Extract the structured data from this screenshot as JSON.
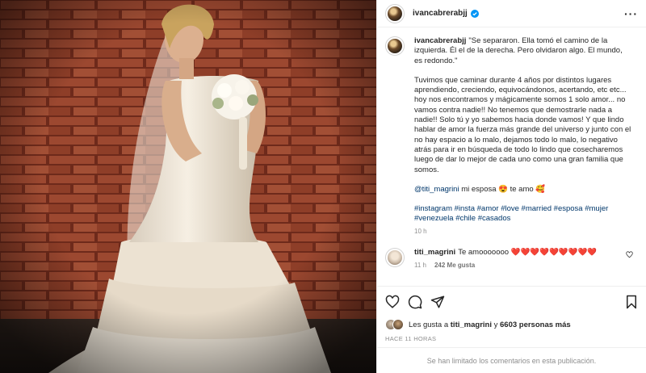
{
  "post": {
    "author": "ivancabrerabjj",
    "more_icon": "more-horizontal-icon",
    "caption": {
      "author": "ivancabrerabjj",
      "quote": "\"Se separaron. Ella tomó el camino de la izquierda. Él el de la derecha. Pero olvidaron algo. El mundo, es redondo.\"",
      "paragraph": "Tuvimos que caminar durante 4 años por distintos lugares aprendiendo, creciendo, equivocándonos, acertando, etc etc... hoy nos encontramos y mágicamente somos 1 solo amor... no vamos contra nadie!! No tenemos que demostrarle nada a nadie!! Solo tú y yo sabemos hacia donde vamos! Y que lindo hablar de amor la fuerza más grande del universo y junto con el no hay espacio a lo malo, dejamos todo lo malo, lo negativo atrás para ir en búsqueda de todo lo lindo que cosecharemos luego de dar lo mejor de cada uno como una gran familia que somos.",
      "mention": "@titi_magrini",
      "mention_text": " mi esposa 😍 te amo 🥰",
      "hashtags": "#instagram #insta #amor #love #married #esposa #mujer #venezuela #chile #casados",
      "time": "10 h"
    },
    "comment": {
      "author": "titi_magrini",
      "text": "Te amooooooo ❤️❤️❤️❤️❤️❤️❤️❤️❤️",
      "time": "11 h",
      "likes": "242 Me gusta"
    },
    "likes_prefix": "Les gusta a ",
    "likes_user": "titi_magrini",
    "likes_mid": " y ",
    "likes_count": "6603 personas más",
    "posted": "HACE 11 HORAS",
    "comments_limited": "Se han limitado los comentarios en esta publicación."
  },
  "colors": {
    "verified": "#0095f6",
    "heart": "#ed4956",
    "link": "#00376b"
  }
}
